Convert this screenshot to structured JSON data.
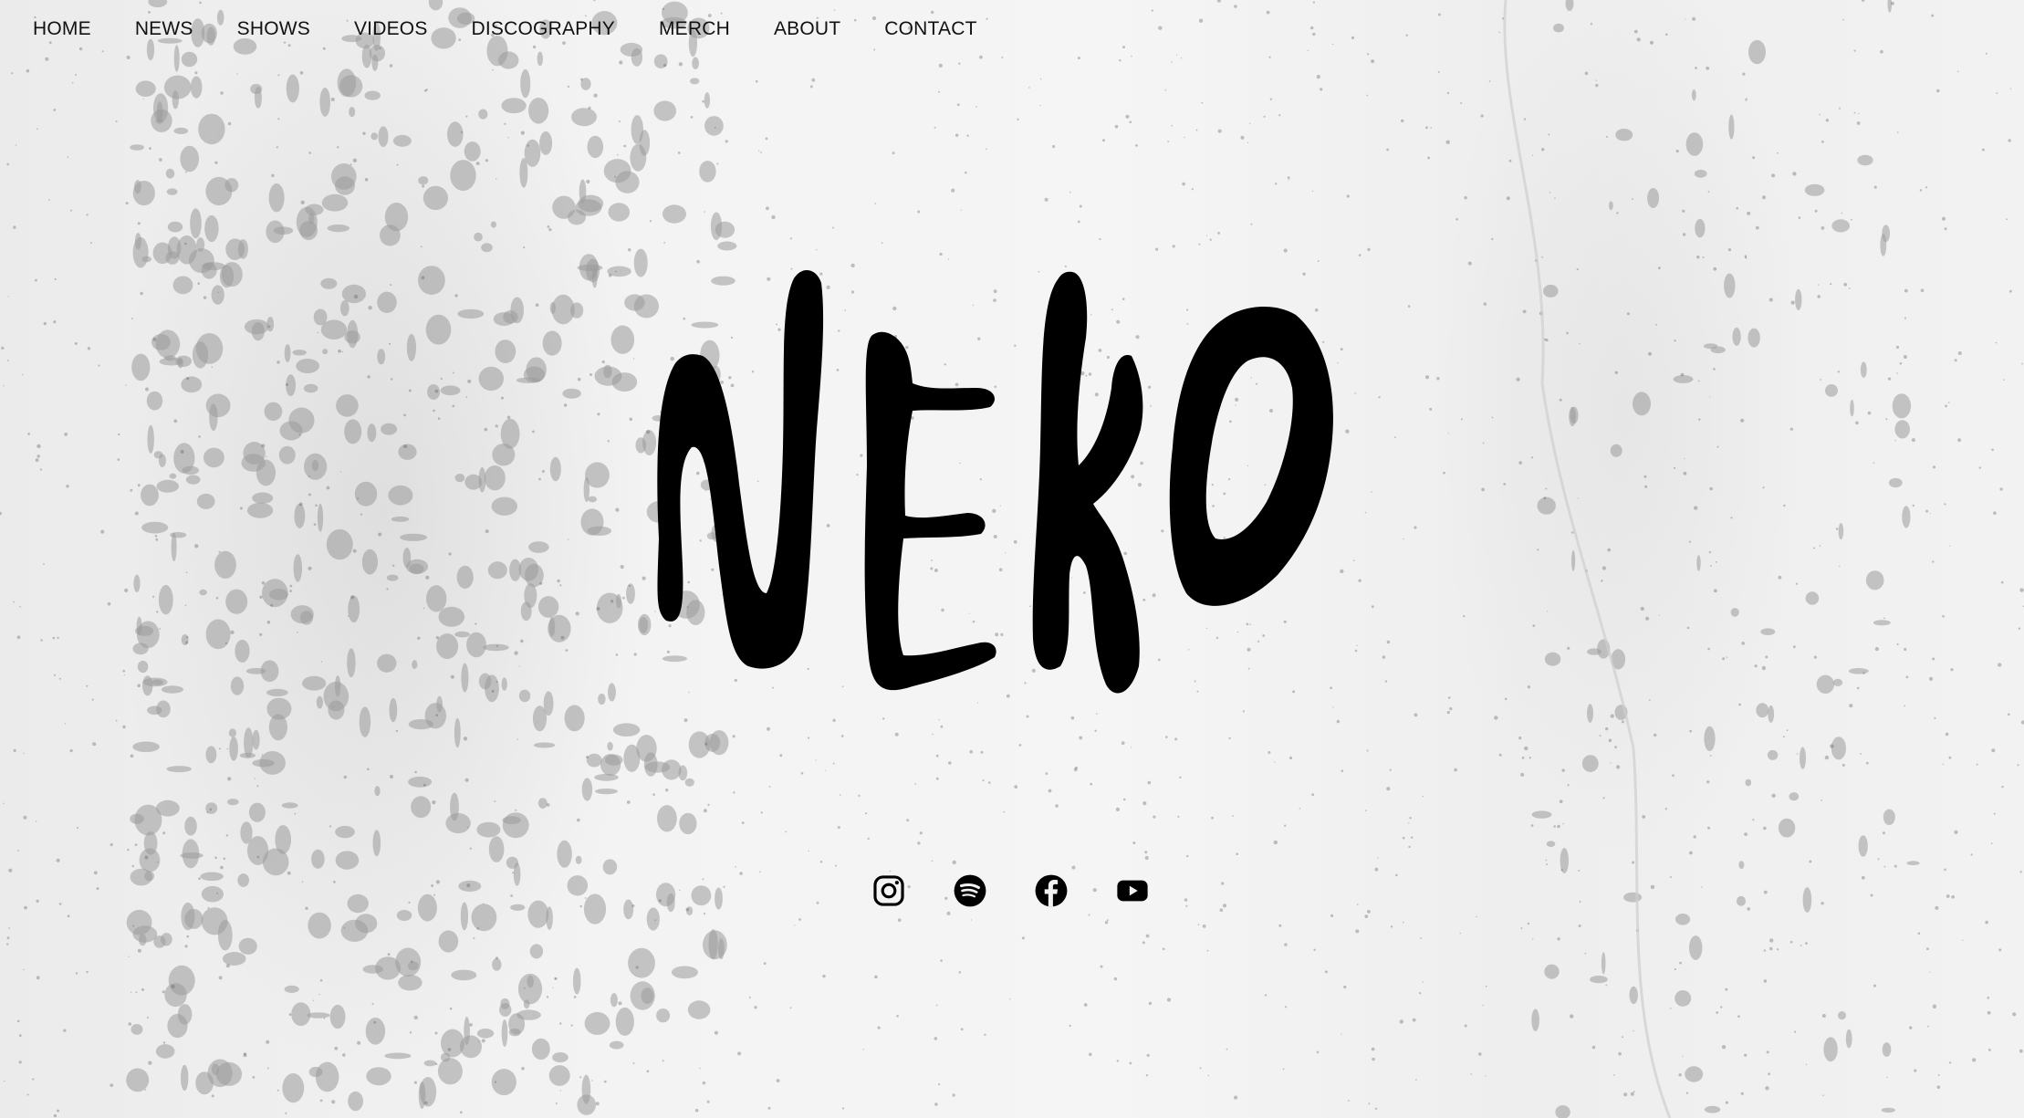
{
  "nav": {
    "items": [
      {
        "label": "HOME"
      },
      {
        "label": "NEWS"
      },
      {
        "label": "SHOWS"
      },
      {
        "label": "VIDEOS"
      },
      {
        "label": "DISCOGRAPHY"
      },
      {
        "label": "MERCH"
      },
      {
        "label": "ABOUT"
      },
      {
        "label": "CONTACT"
      }
    ]
  },
  "logo": {
    "text": "NEKO",
    "color": "#000000"
  },
  "social": {
    "icons": [
      "instagram-icon",
      "spotify-icon",
      "facebook-icon",
      "youtube-icon"
    ]
  },
  "colors": {
    "text": "#111111",
    "background": "#f1f1f1"
  }
}
